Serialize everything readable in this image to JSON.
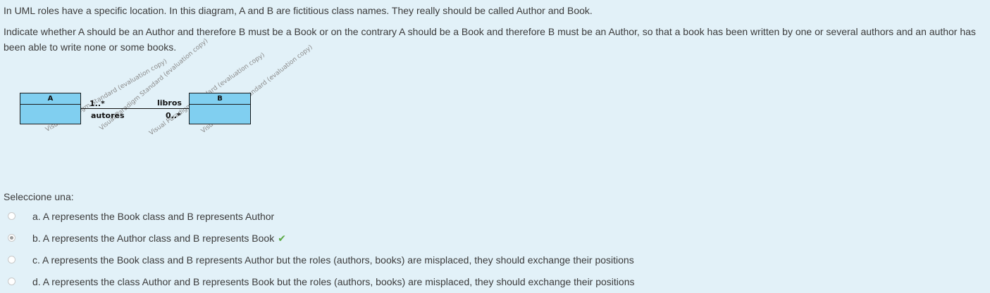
{
  "question": {
    "intro": "In UML roles have a specific location. In this diagram, A and B are fictitious class names. They really should be called Author and Book.",
    "instruction": "Indicate whether A should be an Author and therefore B must be a Book or on the contrary A should be a Book and therefore B must be an Author, so that a book has been written by one or several authors and an author has been able to write none or some books."
  },
  "diagram": {
    "class_a": "A",
    "class_b": "B",
    "mult_a": "1..*",
    "role_a": "autores",
    "role_b": "libros",
    "mult_b": "0..*",
    "watermarks": [
      "Visual Paradigm Standard (evaluation copy)",
      "Visual Paradigm Standard (evaluation copy)",
      "Visual Paradigm Standard (evaluation copy)",
      "Visual Paradigm Standard (evaluation copy)"
    ]
  },
  "answers": {
    "prompt": "Seleccione una:",
    "options": [
      {
        "label": "a. A represents the Book class and B represents Author",
        "selected": false,
        "correct": false
      },
      {
        "label": "b. A represents the Author class and B represents Book",
        "selected": true,
        "correct": true
      },
      {
        "label": "c. A represents the Book class and B represents Author but the roles (authors, books) are misplaced, they should exchange their positions",
        "selected": false,
        "correct": false
      },
      {
        "label": "d. A represents the class Author and B represents Book but the roles (authors, books) are misplaced, they should exchange their positions",
        "selected": false,
        "correct": false
      }
    ],
    "correct_icon": "checkmark-icon",
    "correct_color": "#5aaa45"
  }
}
